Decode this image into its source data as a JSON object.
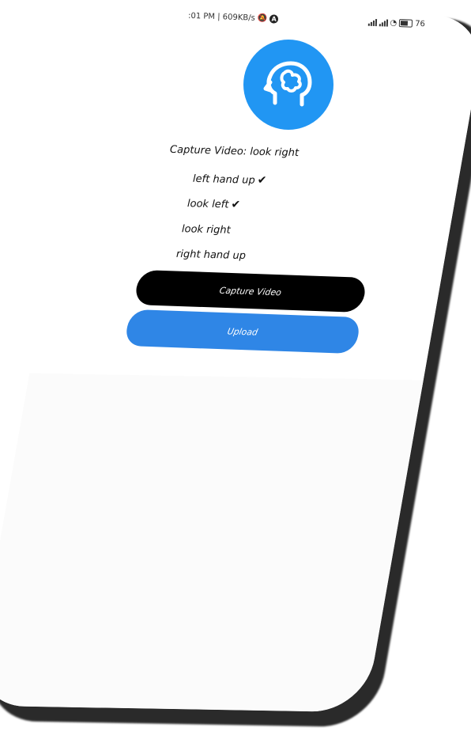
{
  "status_bar": {
    "time_and_speed": ":01 PM | 609KB/s",
    "battery_text": "76"
  },
  "app": {
    "logo_icon": "brain-head-icon",
    "accent_color": "#2196f3",
    "title": "Capture Video: look right",
    "steps": [
      {
        "label": "left hand up",
        "done": true,
        "check": "✔"
      },
      {
        "label": "look left",
        "done": true,
        "check": "✔"
      },
      {
        "label": "look right",
        "done": false,
        "check": ""
      },
      {
        "label": "right hand up",
        "done": false,
        "check": ""
      }
    ],
    "capture_button_label": "Capture Video",
    "upload_button_label": "Upload",
    "capture_button_color": "#000000",
    "upload_button_color": "#2f86e6"
  }
}
